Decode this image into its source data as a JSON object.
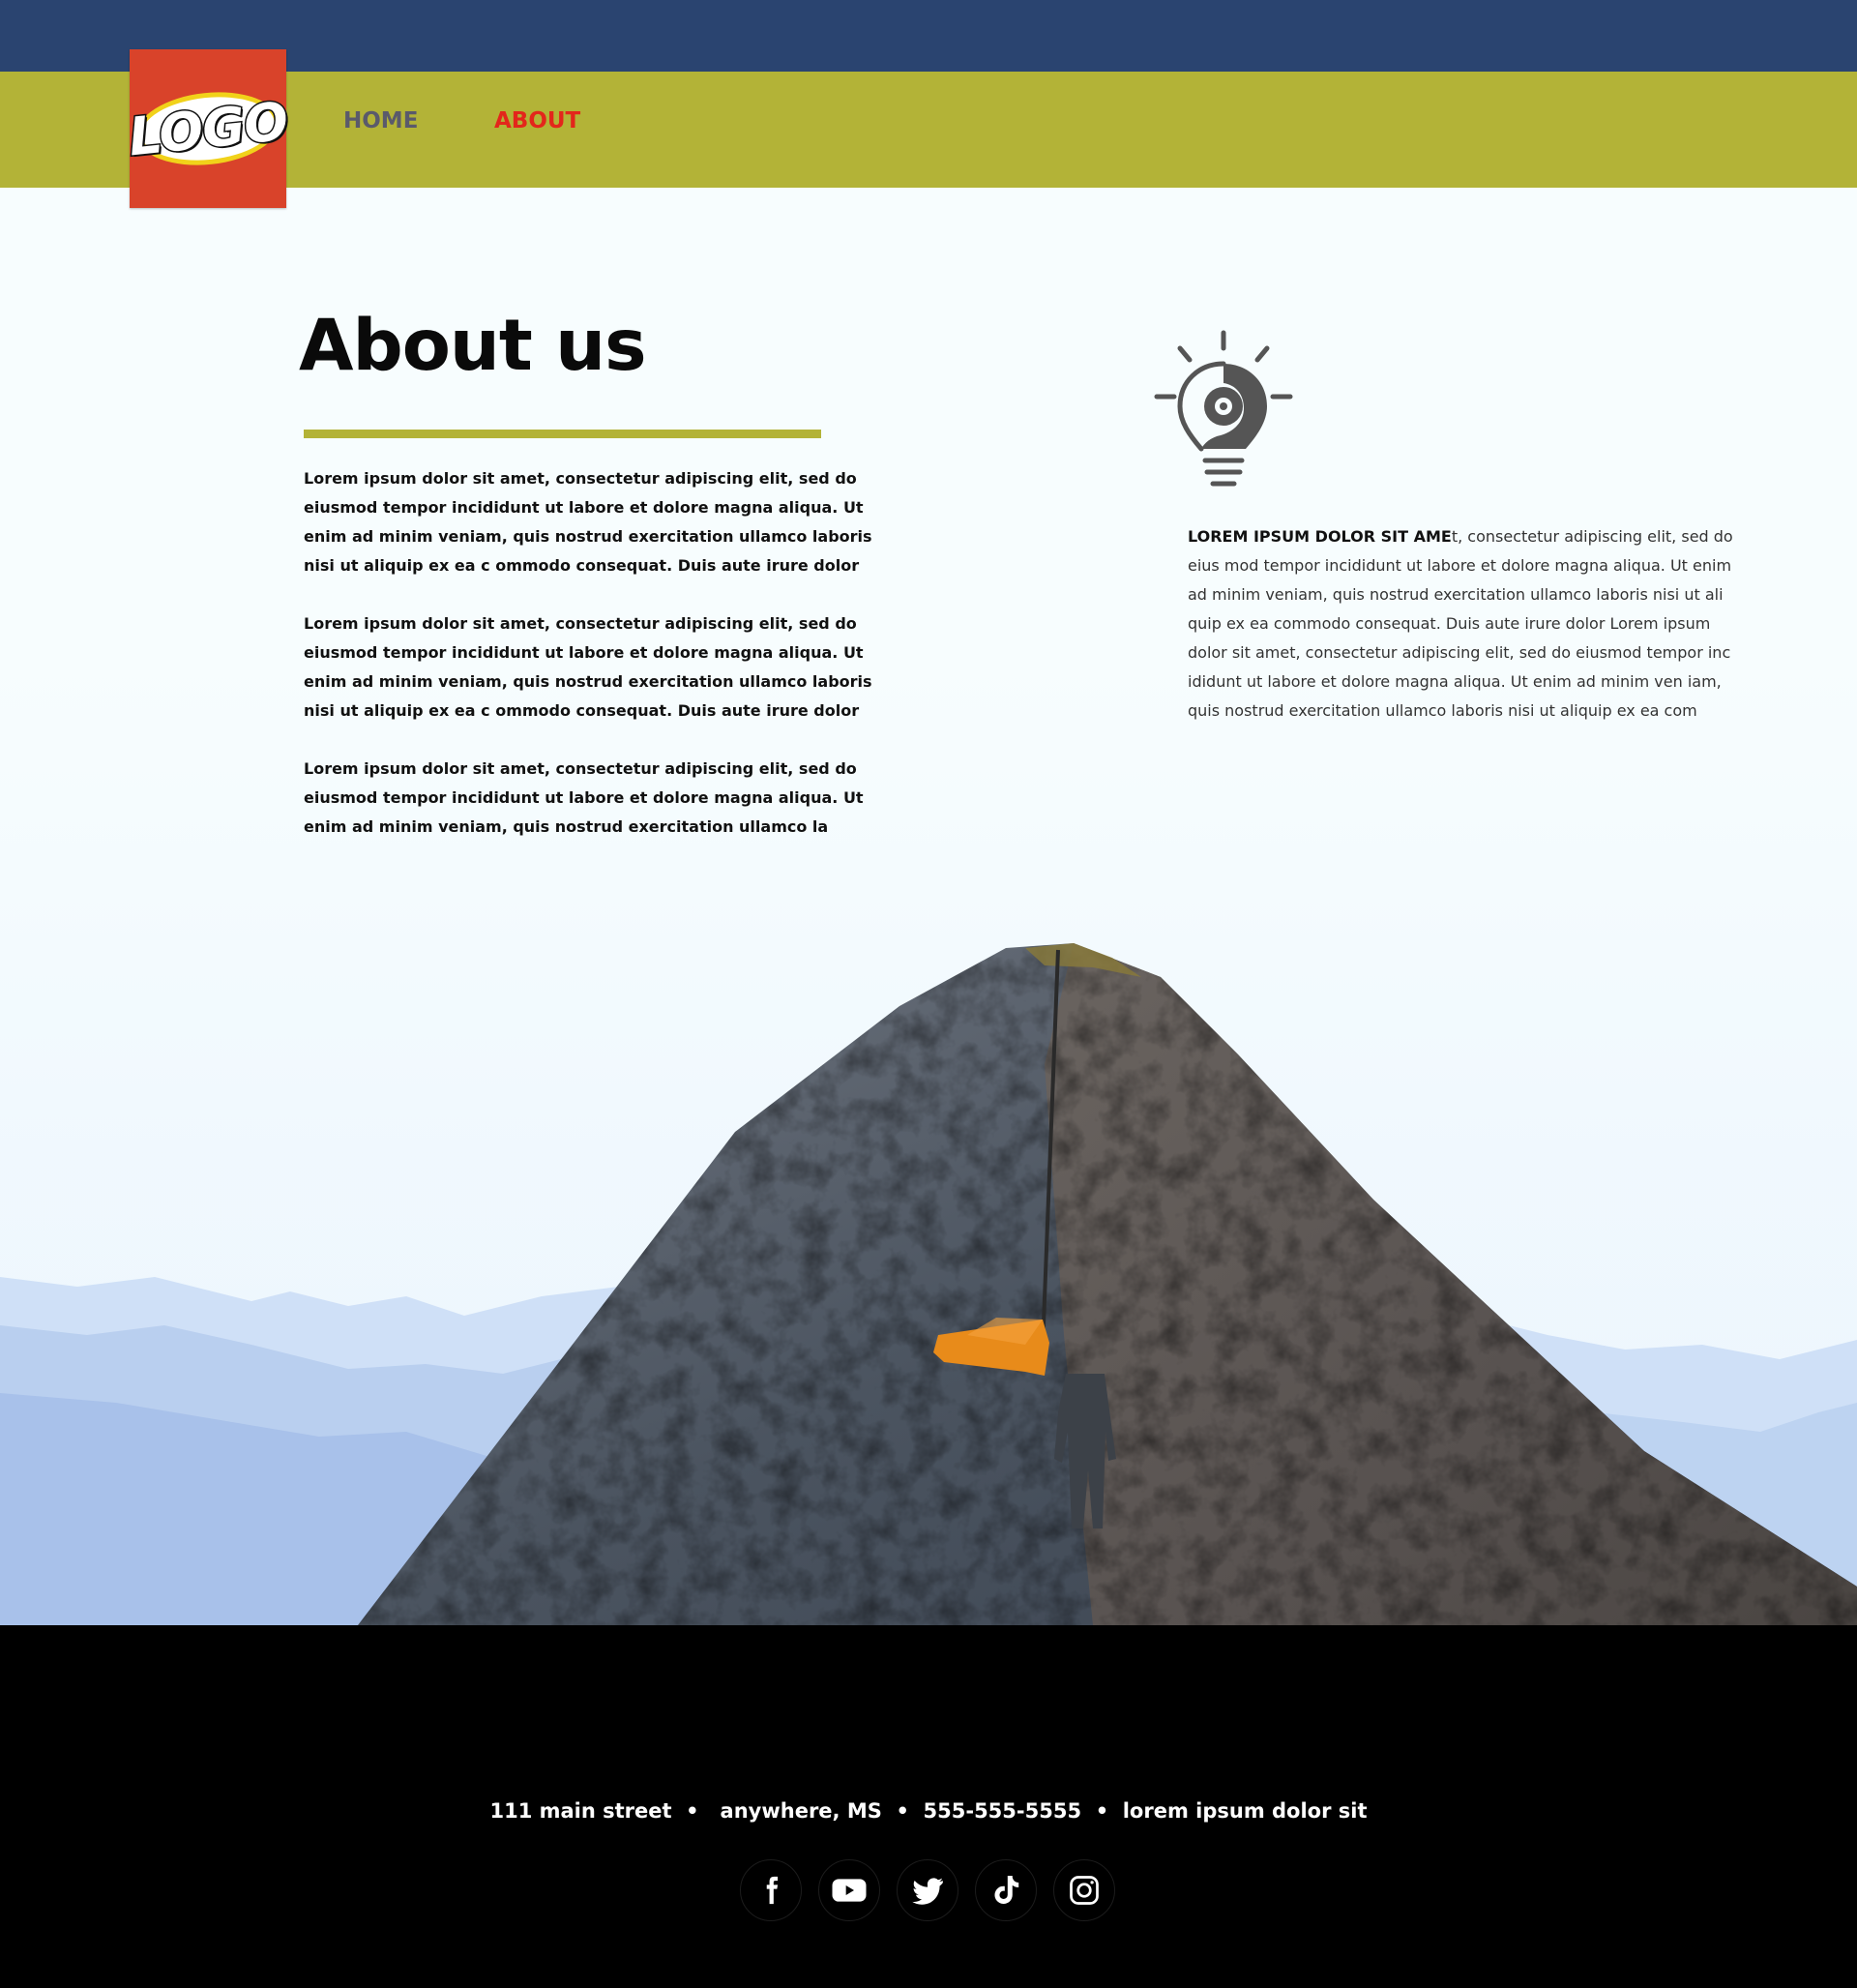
{
  "colors": {
    "topbar": "#2a4470",
    "navbar": "#b3b337",
    "logo_bg": "#d9432a",
    "nav_inactive": "#5a5a6b",
    "nav_active": "#e3261b",
    "accent_rule": "#b3b337",
    "footer": "#000000"
  },
  "header": {
    "logo": {
      "text": "LOGO",
      "icon": "logo"
    },
    "nav": [
      {
        "label": "HOME",
        "active": false
      },
      {
        "label": "ABOUT",
        "active": true
      }
    ]
  },
  "main": {
    "title": "About us",
    "left_paragraphs": [
      "Lorem ipsum dolor sit amet, consectetur adipiscing elit, sed do eiusmod tempor incididunt ut labore et dolore magna aliqua. Ut enim ad minim veniam, quis nostrud exercitation ullamco laboris nisi ut aliquip ex ea c ommodo consequat. Duis aute irure dolor",
      "Lorem ipsum dolor sit amet, consectetur adipiscing elit, sed do eiusmod tempor incididunt ut labore et dolore magna aliqua. Ut enim ad minim veniam, quis nostrud exercitation ullamco laboris nisi ut aliquip ex ea c ommodo consequat. Duis aute irure dolor",
      "Lorem ipsum dolor sit amet, consectetur adipiscing elit, sed do eiusmod tempor incididunt ut labore et dolore magna aliqua. Ut enim ad minim veniam, quis nostrud exercitation ullamco la"
    ],
    "right_icon": "lightbulb-gear-icon",
    "right_lead": "LOREM IPSUM DOLOR SIT AME",
    "right_body": "t, consectetur adipiscing elit, sed do eius mod tempor incididunt ut labore et dolore magna aliqua. Ut enim ad  minim veniam, quis nostrud exercitation ullamco laboris nisi ut ali quip ex ea commodo consequat. Duis aute irure dolor Lorem ipsum  dolor sit amet, consectetur adipiscing elit, sed do eiusmod tempor inc ididunt ut labore et dolore magna aliqua. Ut enim ad minim ven iam, quis nostrud exercitation ullamco laboris nisi ut aliquip ex ea com"
  },
  "footer": {
    "contact": "111 main street  •   anywhere, MS  •  555-555-5555  •  lorem ipsum dolor sit",
    "social": [
      {
        "icon": "facebook-icon"
      },
      {
        "icon": "youtube-icon"
      },
      {
        "icon": "twitter-icon"
      },
      {
        "icon": "tiktok-icon"
      },
      {
        "icon": "instagram-icon"
      }
    ]
  }
}
